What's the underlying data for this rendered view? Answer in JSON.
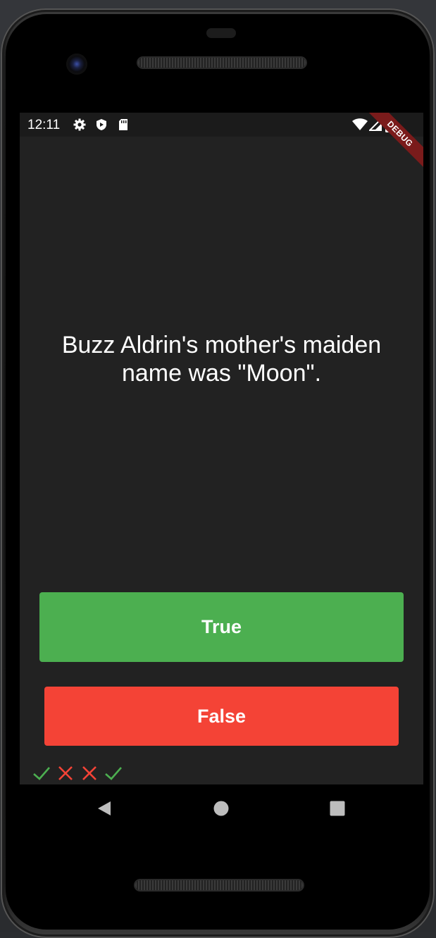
{
  "status_bar": {
    "time": "12:11",
    "left_icons": [
      "gear-icon",
      "shield-icon",
      "sd-card-icon"
    ],
    "right_icons": [
      "wifi-icon",
      "signal-icon",
      "battery-icon"
    ]
  },
  "debug_banner": "DEBUG",
  "quiz": {
    "question": "Buzz Aldrin's mother's maiden name was \"Moon\".",
    "true_label": "True",
    "false_label": "False",
    "true_color": "#4caf50",
    "false_color": "#f44336"
  },
  "score_keeper": [
    "correct",
    "wrong",
    "wrong",
    "correct"
  ],
  "nav_bar": {
    "buttons": [
      "back-icon",
      "home-icon",
      "recents-icon"
    ]
  }
}
